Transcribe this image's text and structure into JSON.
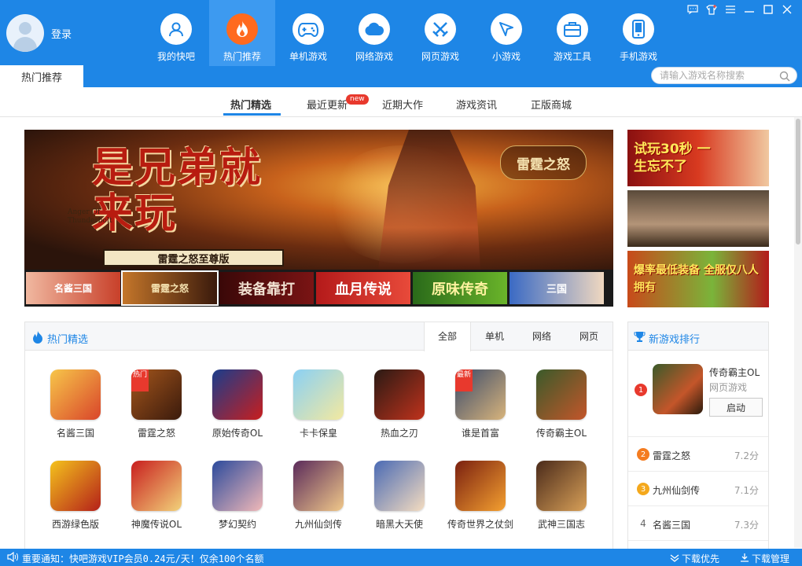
{
  "user": {
    "login_label": "登录"
  },
  "nav": [
    {
      "label": "我的快吧",
      "icon": "user-icon"
    },
    {
      "label": "热门推荐",
      "icon": "flame-icon",
      "active": true
    },
    {
      "label": "单机游戏",
      "icon": "gamepad-icon"
    },
    {
      "label": "网络游戏",
      "icon": "cloud-icon"
    },
    {
      "label": "网页游戏",
      "icon": "crossed-swords-icon"
    },
    {
      "label": "小游戏",
      "icon": "cursor-icon"
    },
    {
      "label": "游戏工具",
      "icon": "toolbox-icon"
    },
    {
      "label": "手机游戏",
      "icon": "phone-icon"
    }
  ],
  "header": {
    "current_tab": "热门推荐",
    "search_placeholder": "请输入游戏名称搜索"
  },
  "subtabs": [
    {
      "label": "热门精选",
      "active": true
    },
    {
      "label": "最近更新",
      "badge": "new"
    },
    {
      "label": "近期大作"
    },
    {
      "label": "游戏资讯"
    },
    {
      "label": "正版商城"
    }
  ],
  "banner": {
    "headline": "是兄弟就来玩",
    "english": "Anger Of Thunderbolt",
    "ribbon": "雷霆之怒至尊版",
    "logo": "雷霆之怒",
    "thumbs": [
      "名酱三国",
      "雷霆之怒",
      "装备靠打",
      "血月传说",
      "原味传奇",
      "三国"
    ]
  },
  "side_ads": [
    {
      "text": "试玩30秒 一生忘不了"
    },
    {
      "text": ""
    },
    {
      "text": "爆率最低装备 全服仅八人拥有"
    }
  ],
  "hot": {
    "title": "热门精选",
    "filters": [
      "全部",
      "单机",
      "网络",
      "网页"
    ],
    "active_filter": "全部",
    "games": [
      {
        "name": "名酱三国",
        "colors": [
          "#f7c64a",
          "#d9452a"
        ]
      },
      {
        "name": "雷霆之怒",
        "colors": [
          "#a4561c",
          "#3a1a0c"
        ],
        "corner": "热门"
      },
      {
        "name": "原始传奇OL",
        "colors": [
          "#1a3d8c",
          "#c81e1e"
        ]
      },
      {
        "name": "卡卡保皇",
        "colors": [
          "#8ad0f4",
          "#f3e9a0"
        ]
      },
      {
        "name": "热血之刃",
        "colors": [
          "#2a1a14",
          "#c0321c"
        ]
      },
      {
        "name": "谁是首富",
        "colors": [
          "#3a4a6a",
          "#d8b47c"
        ],
        "corner": "最新"
      },
      {
        "name": "传奇霸主OL",
        "colors": [
          "#3a5a2a",
          "#c4562a"
        ]
      },
      {
        "name": "西游绿色版",
        "colors": [
          "#f4c21c",
          "#b4201a"
        ]
      },
      {
        "name": "神魔传说OL",
        "colors": [
          "#c81e1e",
          "#f2d27a"
        ]
      },
      {
        "name": "梦幻契约",
        "colors": [
          "#2b4a9c",
          "#f0b8b8"
        ]
      },
      {
        "name": "九州仙剑传",
        "colors": [
          "#5a2a5a",
          "#f0c88a"
        ]
      },
      {
        "name": "暗黑大天使",
        "colors": [
          "#4a6ab4",
          "#f4dcc0"
        ]
      },
      {
        "name": "传奇世界之仗剑",
        "colors": [
          "#7a2010",
          "#f4a030"
        ]
      },
      {
        "name": "武神三国志",
        "colors": [
          "#4a2a1a",
          "#d8a058"
        ]
      }
    ]
  },
  "ranking": {
    "title": "新游戏排行",
    "top": {
      "rank": "1",
      "name": "传奇霸主OL",
      "category": "网页游戏",
      "action": "启动"
    },
    "rows": [
      {
        "rank": "2",
        "name": "雷霆之怒",
        "score": "7.2分"
      },
      {
        "rank": "3",
        "name": "九州仙剑传",
        "score": "7.1分"
      },
      {
        "rank": "4",
        "name": "名酱三国",
        "score": "7.3分"
      }
    ]
  },
  "status": {
    "notice": "重要通知：快吧游戏VIP会员0.24元/天！仅余100个名额",
    "download_priority": "下载优先",
    "download_manage": "下载管理"
  },
  "colors": {
    "brand_blue": "#1e86e6",
    "active_orange": "#ff6a1f",
    "rank_red": "#e8392d",
    "rank_orange": "#f47c20",
    "rank_yellow": "#f4a81c"
  }
}
